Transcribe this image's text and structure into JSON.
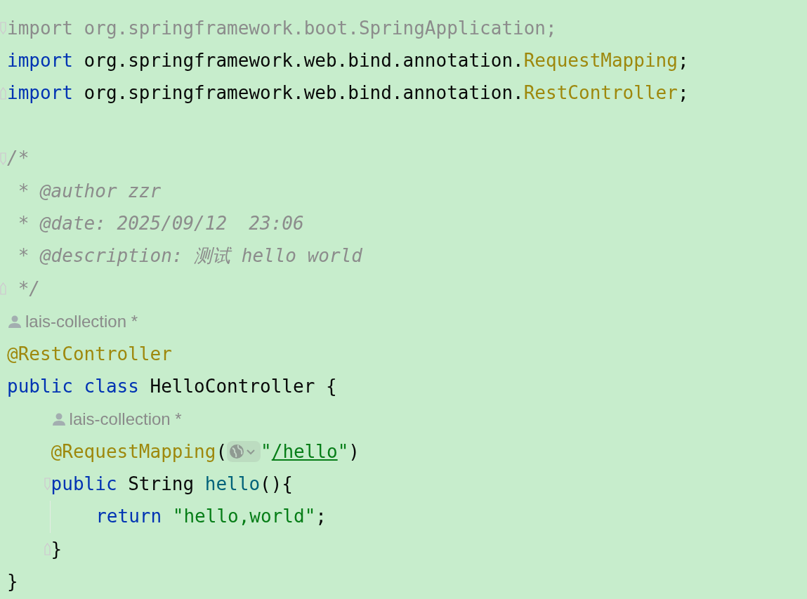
{
  "editor": {
    "lines": [
      {
        "kind": "code",
        "fold_start": true,
        "tokens": [
          {
            "kind": "unused",
            "text": "import org.springframework.boot.SpringApplication;"
          }
        ]
      },
      {
        "kind": "code",
        "tokens": [
          {
            "kind": "keyword",
            "text": "import"
          },
          {
            "kind": "plain",
            "text": " org.springframework.web.bind.annotation."
          },
          {
            "kind": "annotation",
            "text": "RequestMapping"
          },
          {
            "kind": "plain",
            "text": ";"
          }
        ]
      },
      {
        "kind": "code",
        "fold_end": true,
        "tokens": [
          {
            "kind": "keyword",
            "text": "import"
          },
          {
            "kind": "plain",
            "text": " org.springframework.web.bind.annotation."
          },
          {
            "kind": "annotation",
            "text": "RestController"
          },
          {
            "kind": "plain",
            "text": ";"
          }
        ]
      },
      {
        "kind": "blank"
      },
      {
        "kind": "code",
        "fold_start": true,
        "tokens": [
          {
            "kind": "comment",
            "text": "/*"
          }
        ]
      },
      {
        "kind": "code",
        "tokens": [
          {
            "kind": "comment",
            "text": " * @author zzr"
          }
        ]
      },
      {
        "kind": "code",
        "tokens": [
          {
            "kind": "comment",
            "text": " * @date: 2025/09/12  23:06"
          }
        ]
      },
      {
        "kind": "code",
        "tokens": [
          {
            "kind": "comment",
            "text": " * @description: 测试 hello world"
          }
        ]
      },
      {
        "kind": "code",
        "fold_end": true,
        "tokens": [
          {
            "kind": "comment",
            "text": " */"
          }
        ]
      },
      {
        "kind": "author",
        "text": "lais-collection *"
      },
      {
        "kind": "code",
        "tokens": [
          {
            "kind": "annotation",
            "text": "@RestController"
          }
        ]
      },
      {
        "kind": "code",
        "tokens": [
          {
            "kind": "keyword",
            "text": "public class"
          },
          {
            "kind": "plain",
            "text": " HelloController {"
          }
        ],
        "children": [
          {
            "kind": "author",
            "text": "lais-collection *"
          },
          {
            "kind": "code",
            "tokens": [
              {
                "kind": "annotation",
                "text": "@RequestMapping"
              },
              {
                "kind": "plain",
                "text": "("
              },
              {
                "kind": "url-inlay"
              },
              {
                "kind": "string",
                "text": "\""
              },
              {
                "kind": "link",
                "text": "/hello"
              },
              {
                "kind": "string",
                "text": "\""
              },
              {
                "kind": "plain",
                "text": ")"
              }
            ]
          },
          {
            "kind": "code",
            "fold_start": true,
            "tokens": [
              {
                "kind": "keyword",
                "text": "public"
              },
              {
                "kind": "plain",
                "text": " String "
              },
              {
                "kind": "method",
                "text": "hello"
              },
              {
                "kind": "plain",
                "text": "(){"
              }
            ],
            "children": [
              {
                "kind": "code",
                "tokens": [
                  {
                    "kind": "keyword",
                    "text": "return "
                  },
                  {
                    "kind": "string",
                    "text": "\"hello,world\""
                  },
                  {
                    "kind": "plain",
                    "text": ";"
                  }
                ]
              }
            ]
          },
          {
            "kind": "code",
            "fold_end": true,
            "tokens": [
              {
                "kind": "plain",
                "text": "}"
              }
            ]
          }
        ]
      },
      {
        "kind": "code",
        "tokens": [
          {
            "kind": "plain",
            "text": "}"
          }
        ]
      }
    ]
  }
}
